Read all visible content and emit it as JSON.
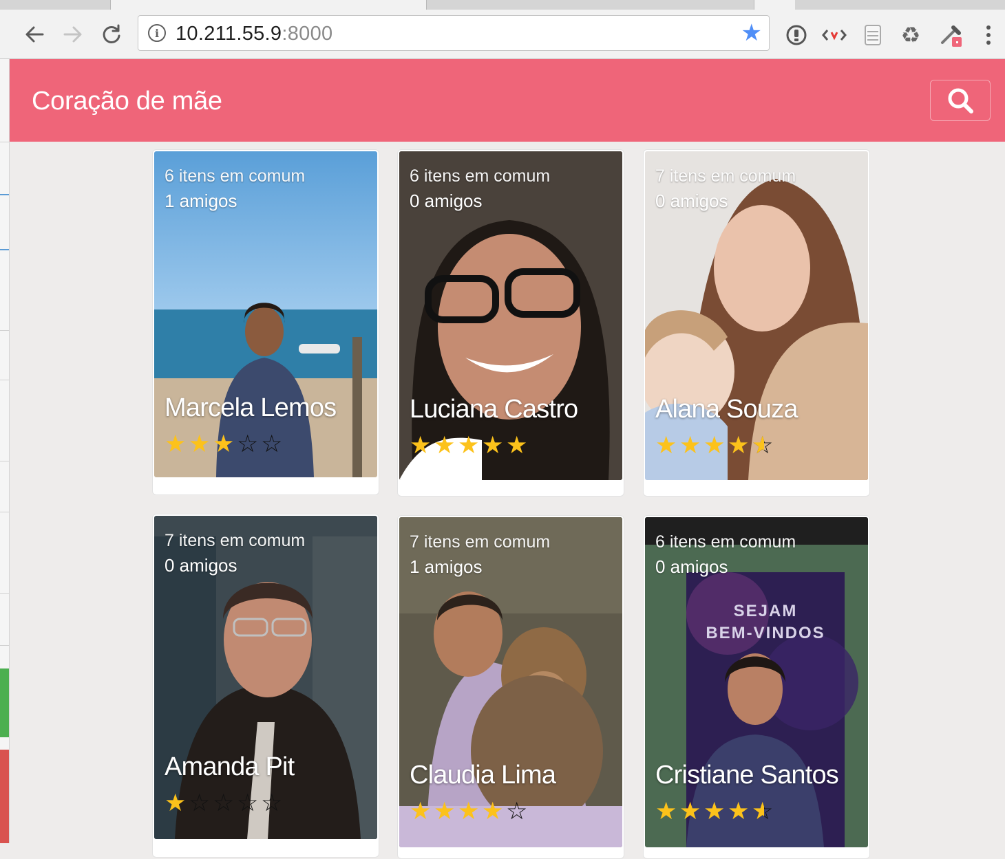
{
  "browser": {
    "url_host": "10.211.55.9",
    "url_port": ":8000"
  },
  "app": {
    "title": "Coração de mãe"
  },
  "colors": {
    "header": "#ef6579",
    "star": "#fcc21b"
  },
  "cards": [
    {
      "common": "6 itens em comum",
      "friends": "1 amigos",
      "name": "Marcela Lemos",
      "rating": 3,
      "rating_label": "3 of 5 stars"
    },
    {
      "common": "6 itens em comum",
      "friends": "0 amigos",
      "name": "Luciana Castro",
      "rating": 5,
      "rating_label": "5 of 5 stars"
    },
    {
      "common": "7 itens em comum",
      "friends": "0 amigos",
      "name": "Alana Souza",
      "rating": 4.5,
      "rating_label": "4.5 of 5 stars"
    },
    {
      "common": "7 itens em comum",
      "friends": "0 amigos",
      "name": "Amanda Pit",
      "rating": 1,
      "rating_label": "1 of 5 stars"
    },
    {
      "common": "7 itens em comum",
      "friends": "1 amigos",
      "name": "Claudia Lima",
      "rating": 4,
      "rating_label": "4 of 5 stars"
    },
    {
      "common": "6 itens em comum",
      "friends": "0 amigos",
      "name": "Cristiane Santos",
      "rating": 4.5,
      "rating_label": "4.5 of 5 stars"
    }
  ]
}
